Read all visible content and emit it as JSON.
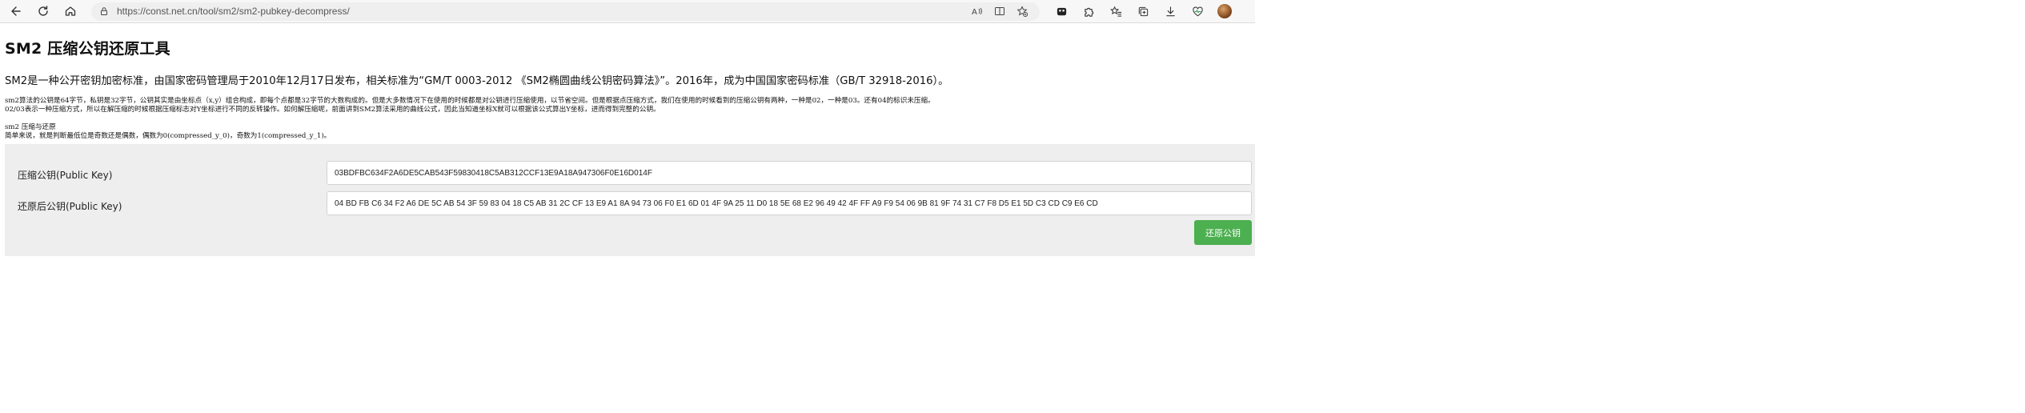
{
  "browser": {
    "url": "https://const.net.cn/tool/sm2/sm2-pubkey-decompress/",
    "icons": {
      "back": "back-arrow-icon",
      "refresh": "refresh-icon",
      "home": "home-icon",
      "lock": "lock-icon",
      "read_aloud": "read-aloud-icon",
      "split_screen": "split-screen-icon",
      "favorite_add": "add-favorite-icon",
      "extensions": "extensions-icon",
      "puzzle": "puzzle-icon",
      "favorites": "favorites-icon",
      "collections": "collections-icon",
      "downloads": "download-icon",
      "performance": "heart-pulse-icon",
      "profile": "avatar"
    }
  },
  "page": {
    "title": "SM2 压缩公钥还原工具",
    "lead": "SM2是一种公开密钥加密标准，由国家密码管理局于2010年12月17日发布，相关标准为“GM/T 0003-2012 《SM2椭圆曲线公钥密码算法》”。2016年，成为中国国家密码标准（GB/T 32918-2016）。",
    "para1_line1": "sm2算法的公钥是64字节，私钥是32字节，公钥其实是由坐标点（x,y）组合构成，即每个点都是32字节的大数构成的。但是大多数情况下在使用的时候都是对公钥进行压缩使用，以节省空间。但是根据点压缩方式，我们在使用的时候看到的压缩公钥有两种，一种是02，一种是03。还有04的标识未压缩。",
    "para1_line2": "02/03表示一种压缩方式，所以在解压缩的时候根据压缩标志对Y坐标进行不同的反转操作。如何解压缩呢，前面讲到SM2算法采用的曲线公式，因此当知道坐标X就可以根据该公式算出Y坐标，进而得到完整的公钥。",
    "para2_line1": "sm2 压缩与还原",
    "para2_line2": "简单来说，就是判断最低位是奇数还是偶数，偶数为0(compressed_y_0)，奇数为1(compressed_y_1)。"
  },
  "form": {
    "compressed_label": "压缩公钥(Public Key)",
    "compressed_value": "03BDFBC634F2A6DE5CAB543F59830418C5AB312CCF13E9A18A947306F0E16D014F",
    "restored_label": "还原后公钥(Public Key)",
    "restored_value": "04 BD FB C6 34 F2 A6 DE 5C AB 54 3F 59 83 04 18 C5 AB 31 2C CF 13 E9 A1 8A 94 73 06 F0 E1 6D 01 4F 9A 25 11 D0 18 5E 68 E2 96 49 42 4F FF A9 F9 54 06 9B 81 9F 74 31 C7 F8 D5 E1 5D C3 CD C9 E6 CD",
    "button_label": "还原公钥",
    "button_color": "#4caf50"
  }
}
